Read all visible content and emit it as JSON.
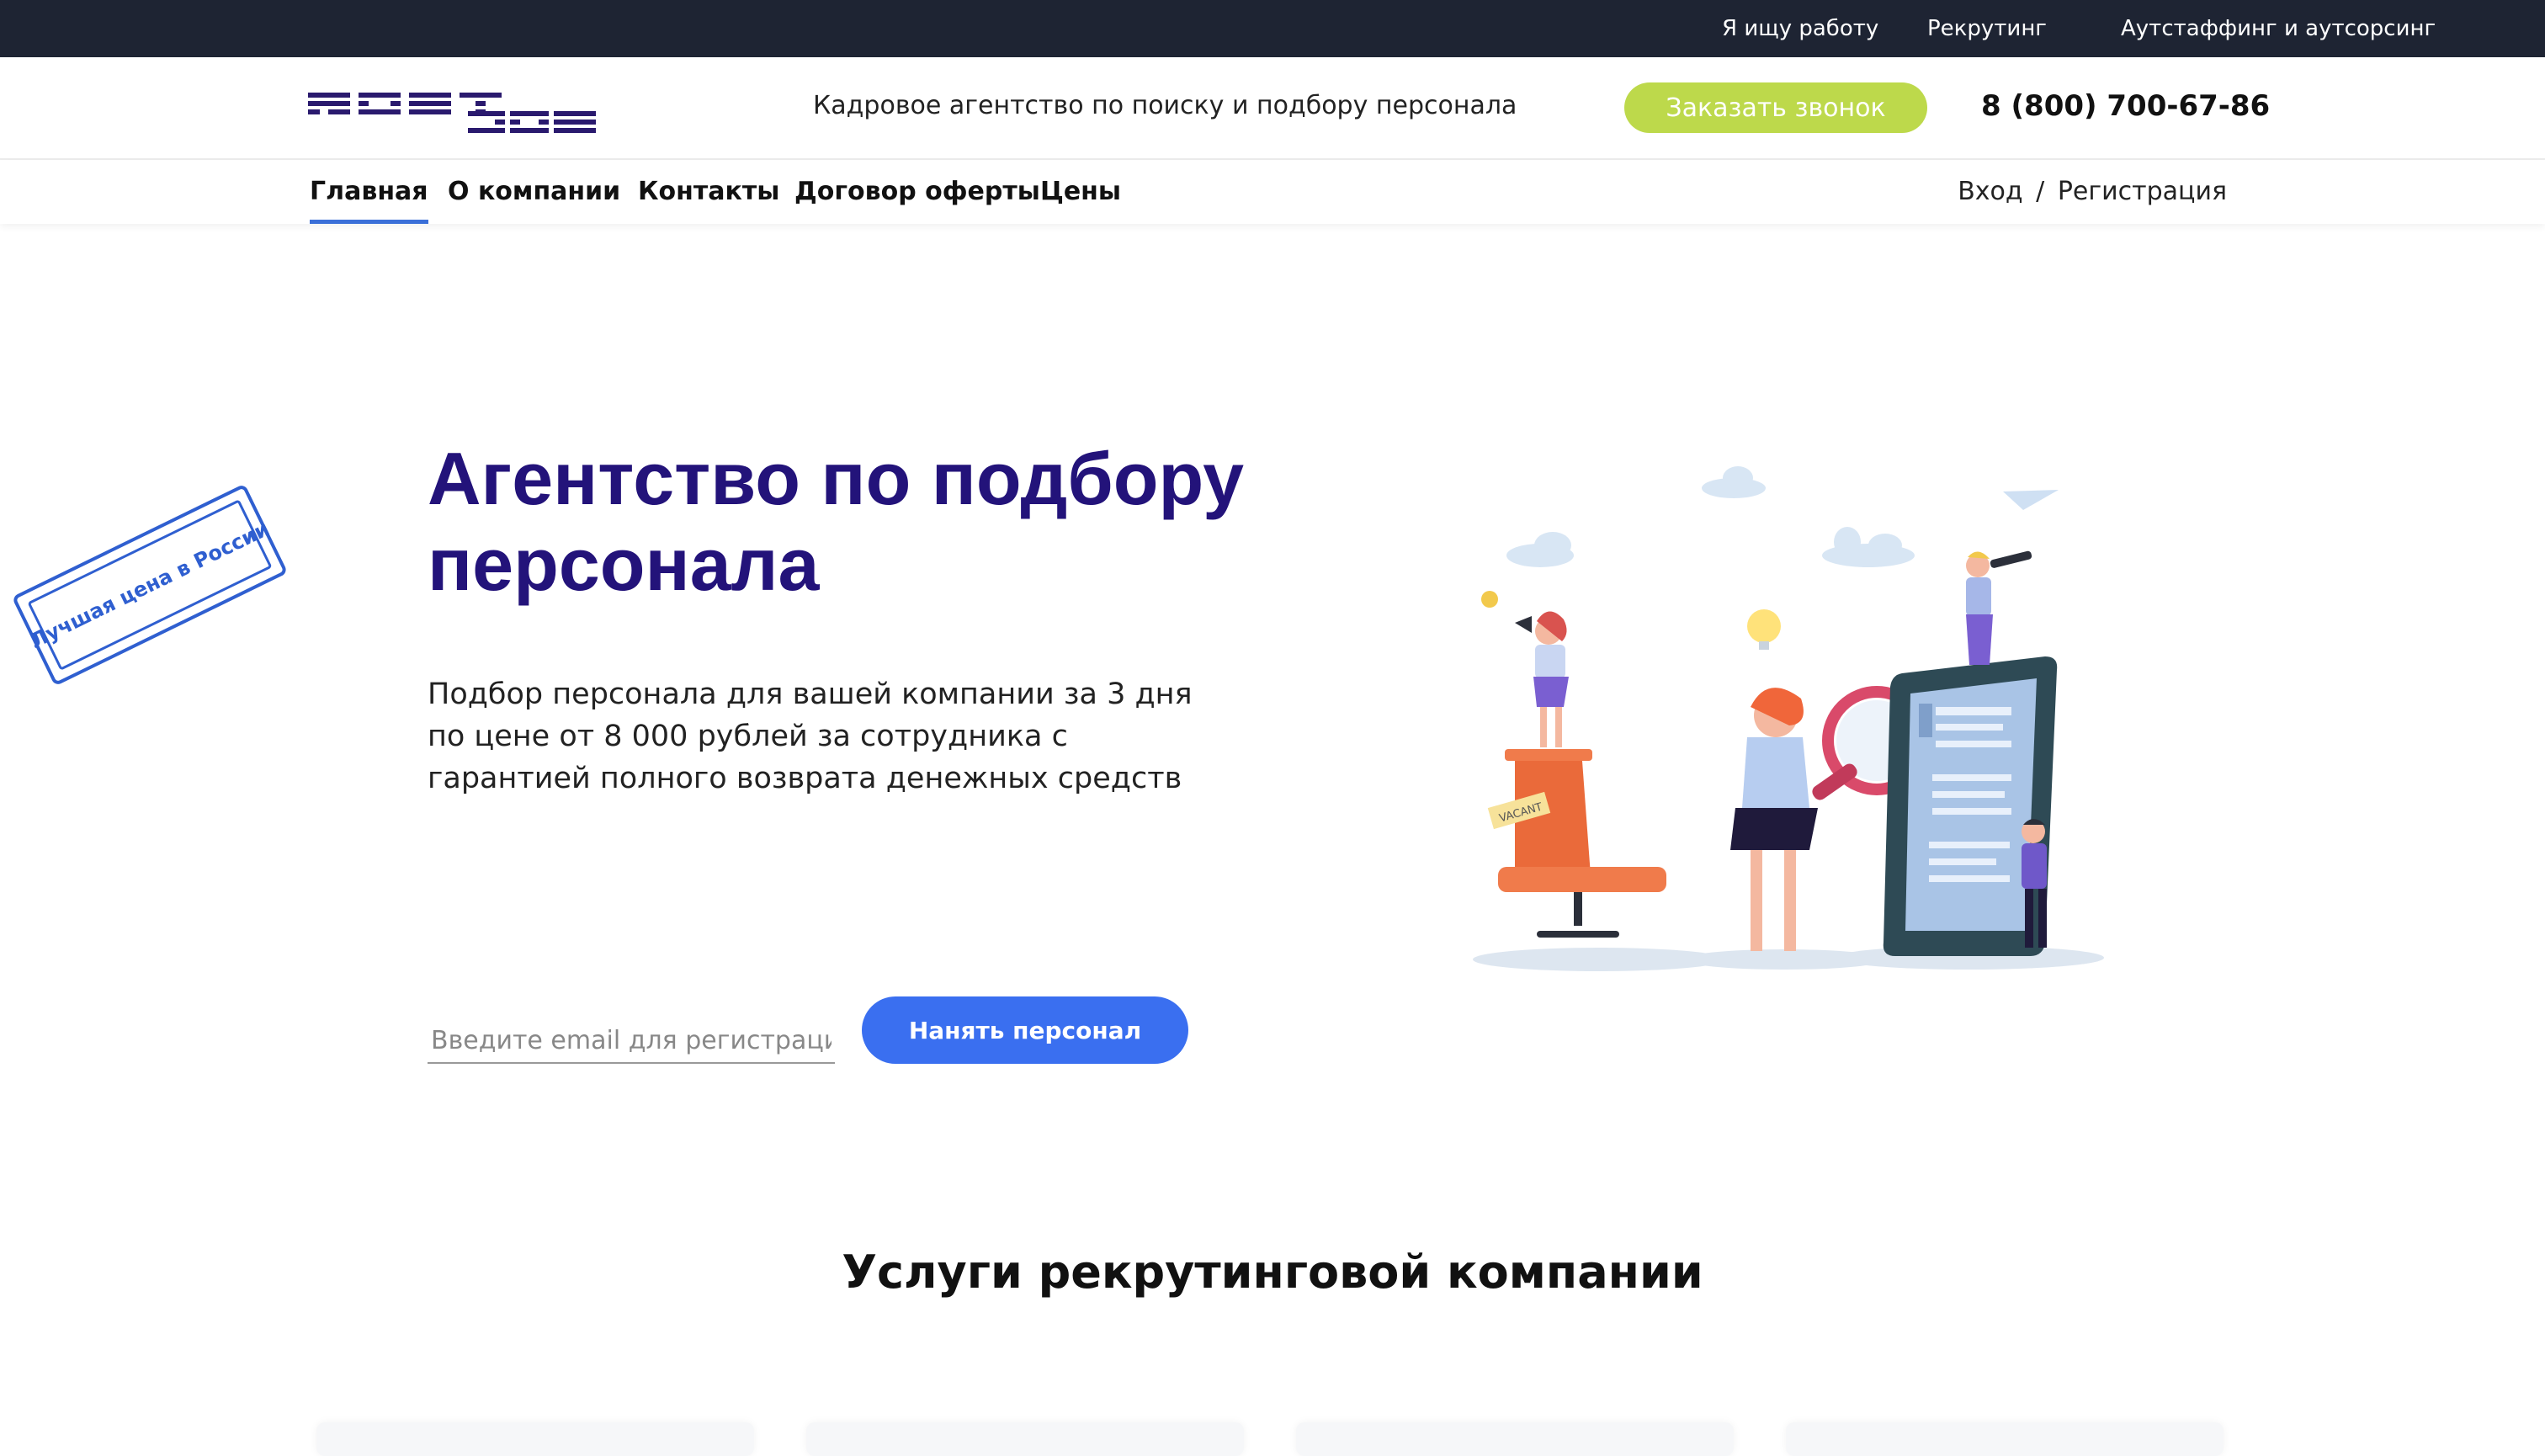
{
  "topbar": {
    "links": [
      "Я ищу работу",
      "Рекрутинг",
      "Аутстаффинг и аутсорсинг"
    ]
  },
  "header": {
    "logo_text": "ROSTJOB",
    "tagline": "Кадровое агентство по поиску и подбору персонала",
    "callback_label": "Заказать звонок",
    "phone": "8 (800) 700-67-86"
  },
  "nav": {
    "items": [
      "Главная",
      "О компании",
      "Контакты",
      "Договор оферты",
      "Цены"
    ],
    "active": "Главная",
    "login": "Вход",
    "separator": "/",
    "register": "Регистрация"
  },
  "stamp": {
    "text": "Лучшая цена в России"
  },
  "hero": {
    "title": "Агентство по подбору персонала",
    "subtitle": "Подбор персонала для вашей компании за 3 дня по цене от 8 000 рублей за сотрудника с гарантией полного возврата денежных средств",
    "email_placeholder": "Введите email для регистрации",
    "hire_button": "Нанять персонал",
    "illustration_sign": "VACANT"
  },
  "services": {
    "title": "Услуги рекрутинговой компании"
  },
  "colors": {
    "topbar": "#1e2433",
    "brand_purple": "#23137a",
    "callback_green": "#bdd94b",
    "primary_blue": "#3a6ff0",
    "stamp_blue": "#2f5fd0"
  }
}
